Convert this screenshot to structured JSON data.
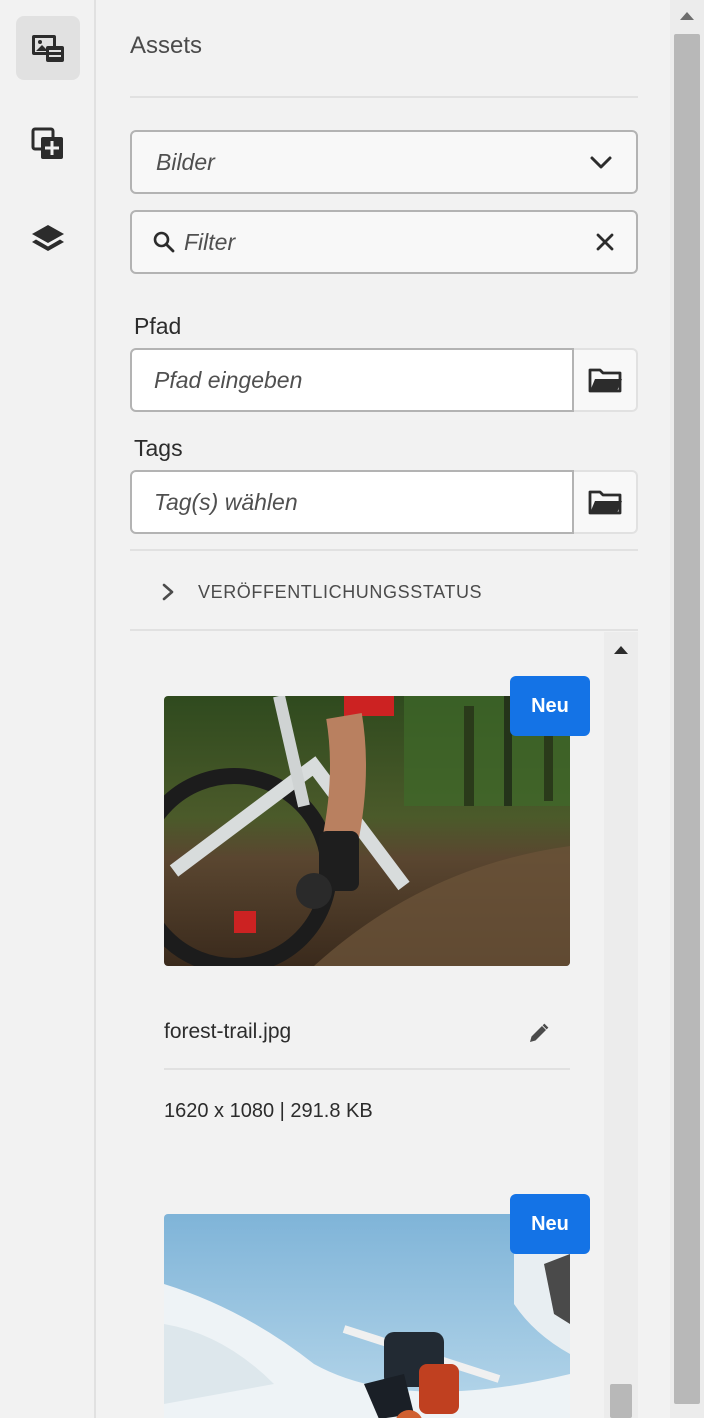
{
  "rail": {
    "items": [
      {
        "icon": "assets-icon",
        "active": true
      },
      {
        "icon": "components-icon",
        "active": false
      },
      {
        "icon": "layers-icon",
        "active": false
      }
    ]
  },
  "panel": {
    "title": "Assets",
    "asset_type": {
      "value": "Bilder"
    },
    "filter": {
      "placeholder": "Filter"
    },
    "path": {
      "label": "Pfad",
      "placeholder": "Pfad eingeben"
    },
    "tags": {
      "label": "Tags",
      "placeholder": "Tag(s) wählen"
    },
    "publication_status": {
      "label": "VERÖFFENTLICHUNGSSTATUS",
      "expanded": false
    }
  },
  "assets": [
    {
      "badge": "Neu",
      "name": "forest-trail.jpg",
      "meta": "1620 x 1080 | 291.8 KB"
    },
    {
      "badge": "Neu"
    }
  ],
  "colors": {
    "accent": "#1473e6",
    "panel_bg": "#f2f2f2",
    "border": "#b3b3b3"
  }
}
